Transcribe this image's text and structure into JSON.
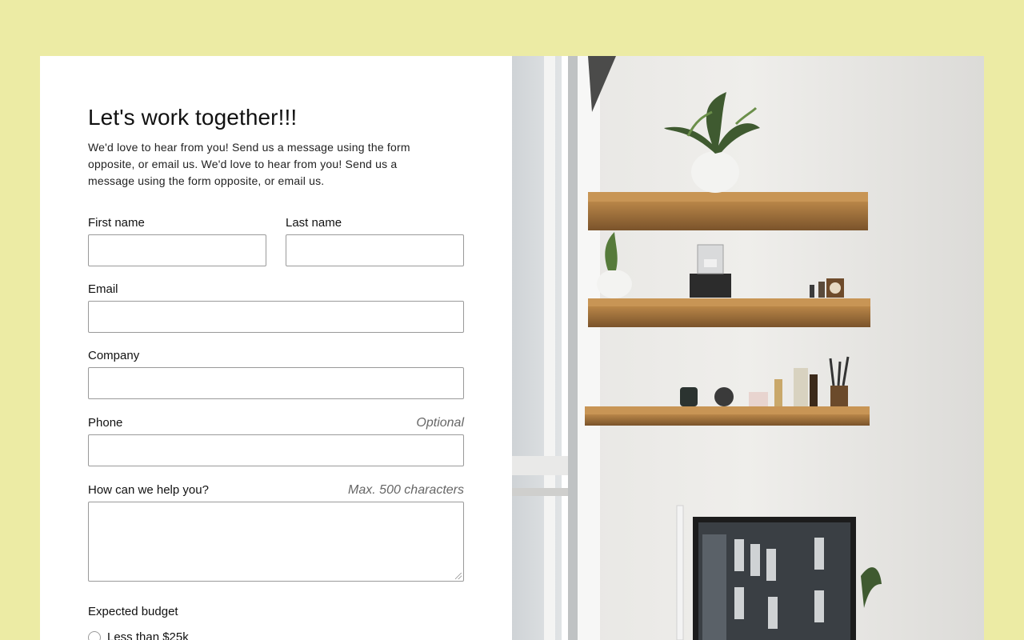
{
  "form": {
    "title": "Let's work together!!!",
    "intro": "We'd love to hear from you! Send us a message using the form opposite, or email us. We'd love to hear from you! Send us a message using the form opposite, or email us.",
    "fields": {
      "first_name": {
        "label": "First name",
        "value": ""
      },
      "last_name": {
        "label": "Last name",
        "value": ""
      },
      "email": {
        "label": "Email",
        "value": ""
      },
      "company": {
        "label": "Company",
        "value": ""
      },
      "phone": {
        "label": "Phone",
        "hint": "Optional",
        "value": ""
      },
      "message": {
        "label": "How can we help you?",
        "hint": "Max. 500 characters",
        "value": ""
      }
    },
    "budget": {
      "label": "Expected budget",
      "options": [
        "Less than $25k"
      ]
    }
  },
  "colors": {
    "page_background": "#eceba4",
    "card_background": "#ffffff",
    "input_border": "#9a9a9a",
    "hint_text": "#666666"
  },
  "photo": {
    "icon": "office-shelves-photo"
  }
}
